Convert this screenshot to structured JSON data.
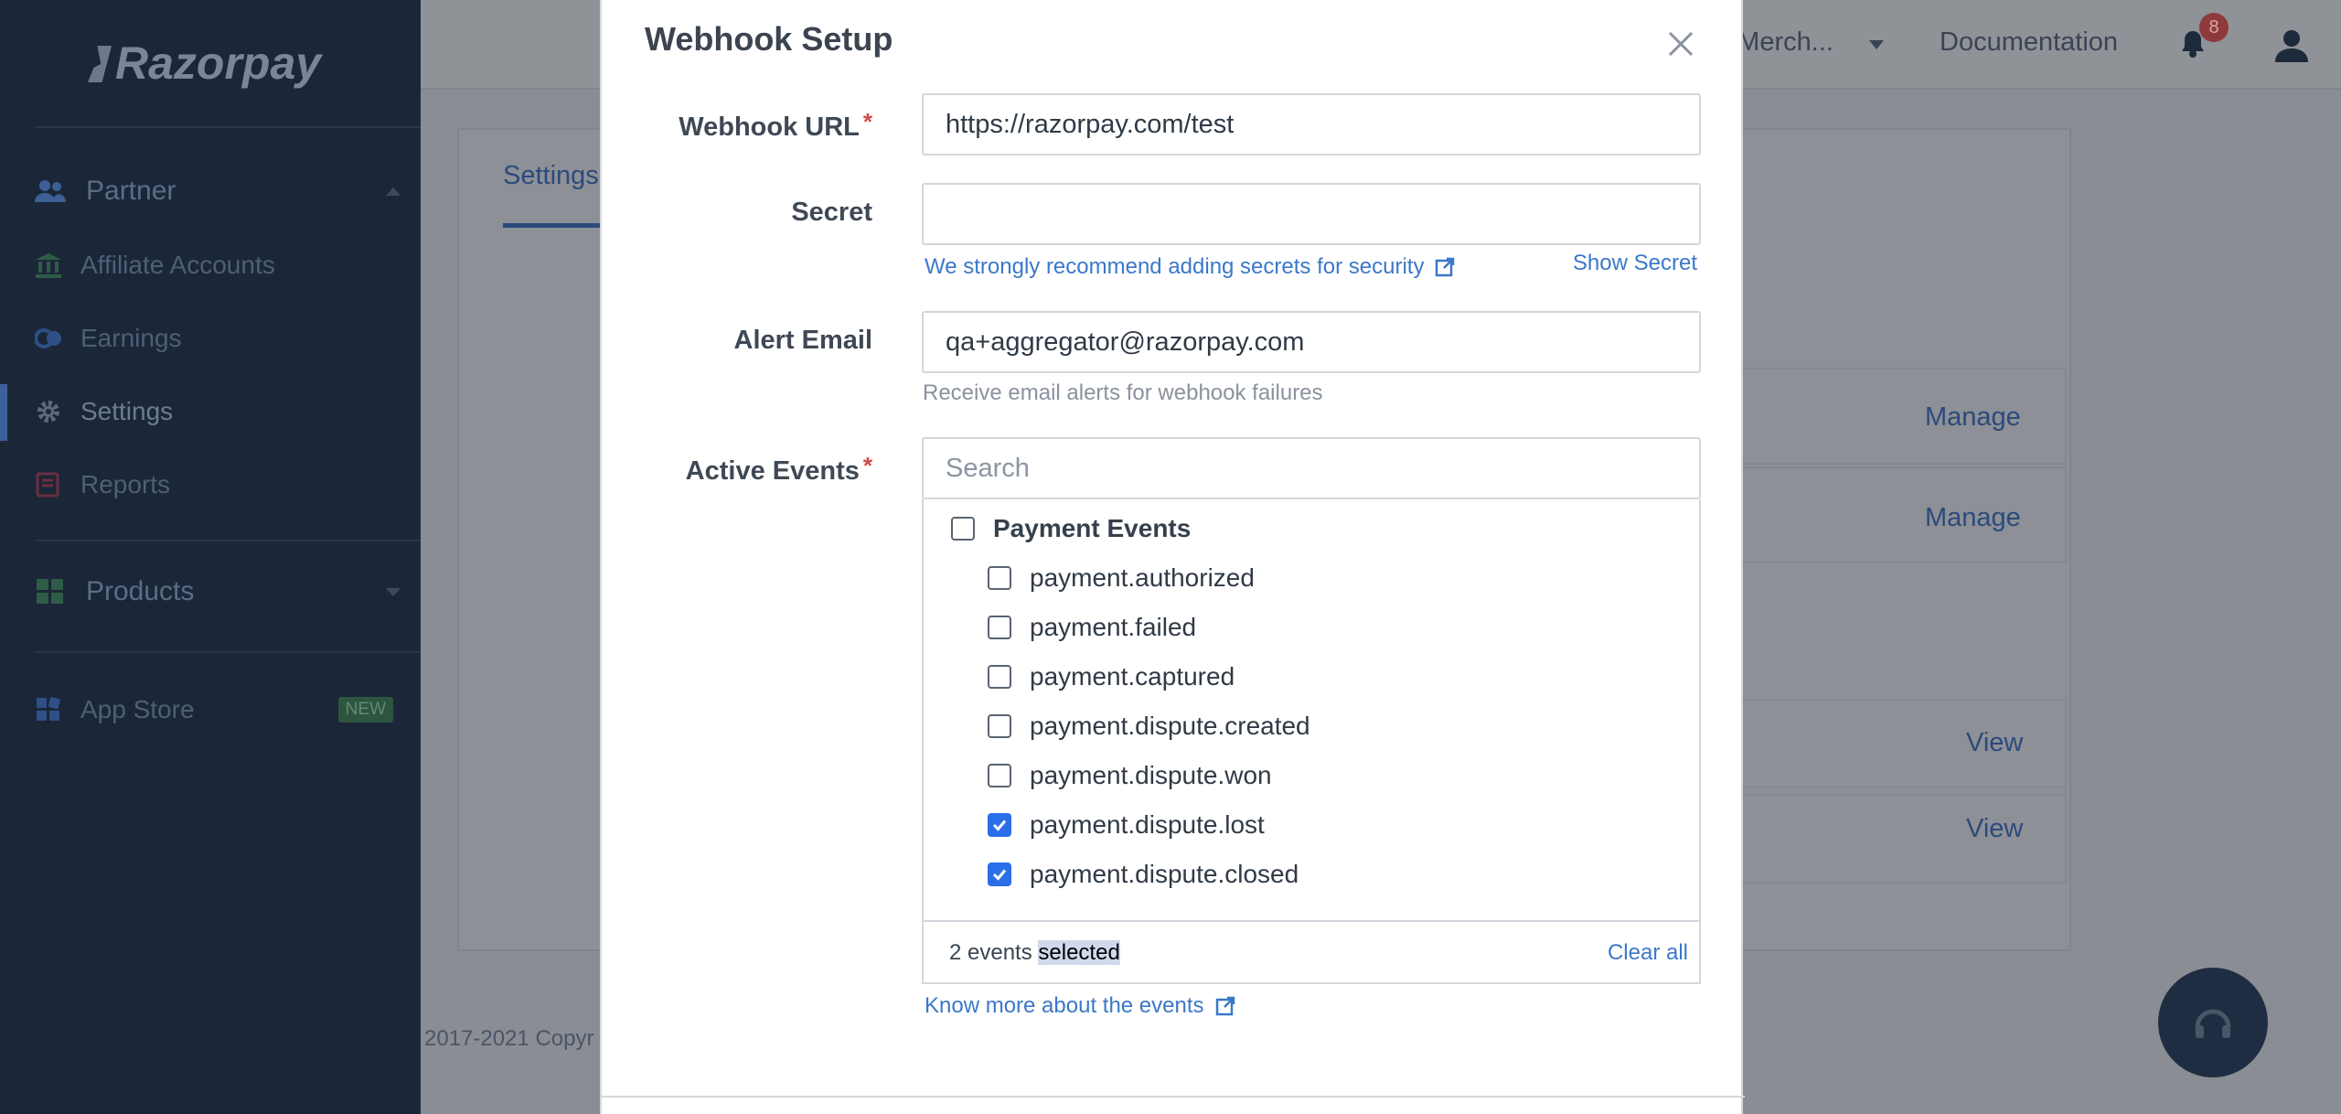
{
  "sidebar": {
    "brand": "Razorpay",
    "sections": [
      {
        "label": "Partner"
      },
      {
        "label": "Products"
      }
    ],
    "items": [
      {
        "label": "Affiliate Accounts"
      },
      {
        "label": "Earnings"
      },
      {
        "label": "Settings"
      },
      {
        "label": "Reports"
      },
      {
        "label": "App Store",
        "badge": "NEW"
      }
    ]
  },
  "topbar": {
    "merchant": "n Merch...",
    "documentation": "Documentation",
    "notifications": "8"
  },
  "background": {
    "tab": "Settings",
    "manage_1": "Manage",
    "manage_2": "Manage",
    "view_1": "View",
    "view_2": "View",
    "copyright": "2017-2021 Copyr"
  },
  "modal": {
    "title": "Webhook Setup",
    "url": {
      "label": "Webhook URL",
      "value": "https://razorpay.com/test"
    },
    "secret": {
      "label": "Secret",
      "value": "",
      "recommend_link": "We strongly recommend adding secrets for security",
      "show_secret": "Show Secret"
    },
    "alert_email": {
      "label": "Alert Email",
      "value": "qa+aggregator@razorpay.com",
      "hint": "Receive email alerts for webhook failures"
    },
    "events": {
      "label": "Active Events",
      "search_placeholder": "Search",
      "group": {
        "label": "Payment Events",
        "checked": false
      },
      "items": [
        {
          "label": "payment.authorized",
          "checked": false
        },
        {
          "label": "payment.failed",
          "checked": false
        },
        {
          "label": "payment.captured",
          "checked": false
        },
        {
          "label": "payment.dispute.created",
          "checked": false
        },
        {
          "label": "payment.dispute.won",
          "checked": false
        },
        {
          "label": "payment.dispute.lost",
          "checked": true
        },
        {
          "label": "payment.dispute.closed",
          "checked": true
        }
      ],
      "count_prefix": "2 events",
      "count_suffix": "selected",
      "clear_all": "Clear all",
      "know_more": "Know more about the events"
    }
  },
  "colors": {
    "accent": "#3b78c9",
    "checkbox": "#2b6fe8",
    "required": "#d04a4a",
    "sidebar": "#1b2738"
  }
}
